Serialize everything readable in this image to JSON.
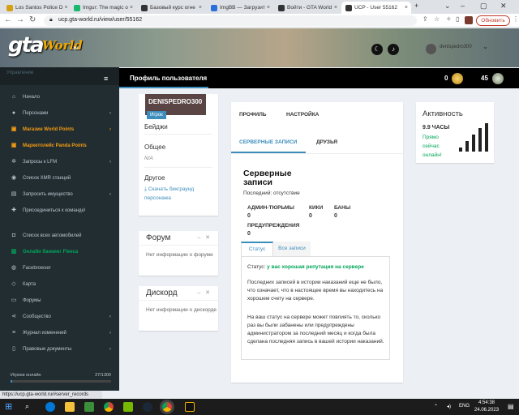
{
  "browser": {
    "tabs": [
      {
        "label": "Los Santos Police D",
        "color": "#d4a017",
        "active": false
      },
      {
        "label": "Imgur: The magic o",
        "color": "#1bb76e",
        "active": false
      },
      {
        "label": "Базовый курс огне",
        "color": "#333333",
        "active": false
      },
      {
        "label": "ImgBB — Загрузит",
        "color": "#2a6fdb",
        "active": false
      },
      {
        "label": "Войти - GTA World",
        "color": "#333333",
        "active": false
      },
      {
        "label": "UCP - User 55162",
        "color": "#333333",
        "active": true
      }
    ],
    "url": "ucp.gta-world.ru/view/user/55162",
    "update_button": "Обновить",
    "status_url": "https://ucp.gta-world.ru/#server_records"
  },
  "banner": {
    "logo_main": "gta",
    "logo_script": "World",
    "logo_suffix": ".ru",
    "username": "denispedro300"
  },
  "sidebar": {
    "title": "Управление",
    "items": [
      {
        "label": "Начало",
        "icon": "home-icon",
        "glyph": "⌂",
        "style": "",
        "chevron": false
      },
      {
        "label": "Персонажи",
        "icon": "user-icon",
        "glyph": "●",
        "style": "",
        "chevron": true
      },
      {
        "label": "Магазин World Points",
        "icon": "cart-icon",
        "glyph": "▣",
        "style": "orange",
        "chevron": true
      },
      {
        "label": "Маркетплейс Panda Points",
        "icon": "cart-icon",
        "glyph": "▣",
        "style": "orange",
        "chevron": false
      },
      {
        "label": "Запросы к LFM",
        "icon": "gear-icon",
        "glyph": "✲",
        "style": "",
        "chevron": true
      },
      {
        "label": "Список XMR станций",
        "icon": "station-icon",
        "glyph": "◉",
        "style": "",
        "chevron": false
      },
      {
        "label": "Запросить имущество",
        "icon": "box-icon",
        "glyph": "▤",
        "style": "",
        "chevron": true
      },
      {
        "label": "Присоединиться к команде!",
        "icon": "user-plus-icon",
        "glyph": "✚",
        "style": "",
        "chevron": false
      },
      {
        "label": "Список всех автомобилей",
        "icon": "car-icon",
        "glyph": "◘",
        "style": "",
        "chevron": false
      },
      {
        "label": "Онлайн банкинг Fleeca",
        "icon": "bank-icon",
        "glyph": "▥",
        "style": "green",
        "chevron": false
      },
      {
        "label": "Facebrowser",
        "icon": "globe-icon",
        "glyph": "◍",
        "style": "",
        "chevron": false
      },
      {
        "label": "Карта",
        "icon": "map-icon",
        "glyph": "◇",
        "style": "",
        "chevron": false
      },
      {
        "label": "Форумы",
        "icon": "forum-icon",
        "glyph": "▭",
        "style": "",
        "chevron": false
      },
      {
        "label": "Сообщество",
        "icon": "share-icon",
        "glyph": "⋖",
        "style": "",
        "chevron": true
      },
      {
        "label": "Журнал изменений",
        "icon": "log-icon",
        "glyph": "≡",
        "style": "",
        "chevron": true
      },
      {
        "label": "Правовые документы",
        "icon": "doc-icon",
        "glyph": "▯",
        "style": "",
        "chevron": true
      }
    ],
    "online_label": "Игроки онлайн",
    "online_count": "27/1300",
    "online_fraction": 0.02
  },
  "topnav": {
    "page_title": "Профиль пользователя",
    "points_1": "0",
    "points_2": "45"
  },
  "profile": {
    "name": "DENISPEDRO300",
    "role": "Игрок",
    "badges_label": "Бейджи",
    "general_label": "Общее",
    "general_value": "N/A",
    "other_label": "Другое",
    "download_link": "Скачать бекграунд персонажа"
  },
  "forum_box": {
    "title": "Форум",
    "body": "Нет информации о форуме"
  },
  "discord_box": {
    "title": "Дискорд",
    "body": "Нет информации о дискорде"
  },
  "main": {
    "tabs": [
      "ПРОФИЛЬ",
      "НАСТРОЙКА",
      "СЕРВЕРНЫЕ ЗАПИСИ",
      "ДРУЗЬЯ"
    ],
    "section_title": "Серверные записи",
    "last_seen": "Последний: отсутствие",
    "stats": [
      {
        "label": "АДМИН-ТЮРЬМЫ",
        "value": "0"
      },
      {
        "label": "КИКИ",
        "value": "0"
      },
      {
        "label": "БАНЫ",
        "value": "0"
      },
      {
        "label": "ПРЕДУПРЕЖДЕНИЯ",
        "value": "0"
      }
    ],
    "subtabs": [
      "Статус",
      "Все записи"
    ],
    "status_prefix": "Статус:",
    "status_value": "у вас хорошая репутация на сервере",
    "paragraph1": "Последних записей в истории наказаний еще не было, что означает, что в настоящее время вы находитесь на хорошем счету на сервере.",
    "paragraph2": "На ваш статус на сервере может повлиять то, сколько раз вы были забанены или предупреждены администратором за последний месяц и когда была сделана последняя запись в вашей истории наказаний."
  },
  "activity": {
    "title": "Активность",
    "hours": "9.9 ЧАСЫ",
    "online_now": "Прямо сейчас онлайн!"
  },
  "taskbar": {
    "lang": "ENG",
    "time": "4:54:38",
    "date": "24.06.2023"
  }
}
